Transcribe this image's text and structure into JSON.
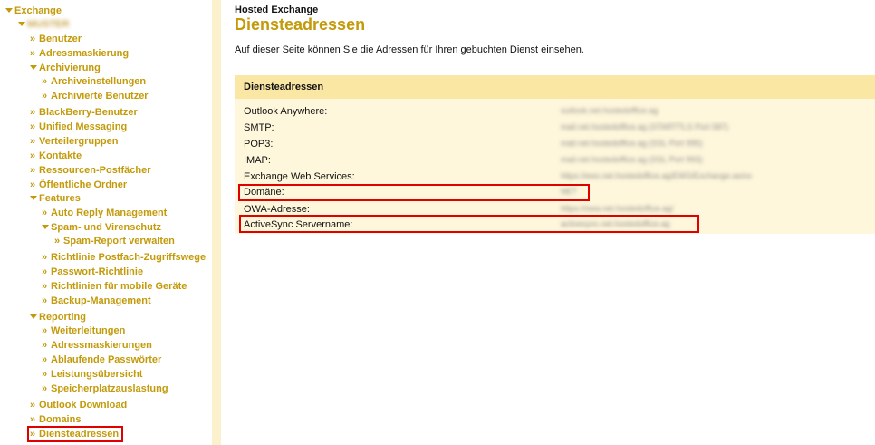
{
  "sidebar": {
    "root": "Exchange",
    "tenant": "MUSTER",
    "items": [
      {
        "label": "Benutzer",
        "level": 1,
        "marker": "»"
      },
      {
        "label": "Adressmaskierung",
        "level": 1,
        "marker": "»"
      },
      {
        "label": "Archivierung",
        "level": 1,
        "marker": "▾"
      },
      {
        "label": "Archiveinstellungen",
        "level": 2,
        "marker": "»"
      },
      {
        "label": "Archivierte Benutzer",
        "level": 2,
        "marker": "»"
      },
      {
        "label": "BlackBerry-Benutzer",
        "level": 1,
        "marker": "»"
      },
      {
        "label": "Unified Messaging",
        "level": 1,
        "marker": "»"
      },
      {
        "label": "Verteilergruppen",
        "level": 1,
        "marker": "»"
      },
      {
        "label": "Kontakte",
        "level": 1,
        "marker": "»"
      },
      {
        "label": "Ressourcen-Postfächer",
        "level": 1,
        "marker": "»"
      },
      {
        "label": "Öffentliche Ordner",
        "level": 1,
        "marker": "»"
      },
      {
        "label": "Features",
        "level": 1,
        "marker": "▾"
      },
      {
        "label": "Auto Reply Management",
        "level": 2,
        "marker": "»"
      },
      {
        "label": "Spam- und Virenschutz",
        "level": 2,
        "marker": "▾"
      },
      {
        "label": "Spam-Report verwalten",
        "level": 3,
        "marker": "»"
      },
      {
        "label": "Richtlinie Postfach-Zugriffswege",
        "level": 2,
        "marker": "»"
      },
      {
        "label": "Passwort-Richtlinie",
        "level": 2,
        "marker": "»"
      },
      {
        "label": "Richtlinien für mobile Geräte",
        "level": 2,
        "marker": "»"
      },
      {
        "label": "Backup-Management",
        "level": 2,
        "marker": "»"
      },
      {
        "label": "Reporting",
        "level": 1,
        "marker": "▾"
      },
      {
        "label": "Weiterleitungen",
        "level": 2,
        "marker": "»"
      },
      {
        "label": "Adressmaskierungen",
        "level": 2,
        "marker": "»"
      },
      {
        "label": "Ablaufende Passwörter",
        "level": 2,
        "marker": "»"
      },
      {
        "label": "Leistungsübersicht",
        "level": 2,
        "marker": "»"
      },
      {
        "label": "Speicherplatzauslastung",
        "level": 2,
        "marker": "»"
      },
      {
        "label": "Outlook Download",
        "level": 1,
        "marker": "»"
      },
      {
        "label": "Domains",
        "level": 1,
        "marker": "»"
      },
      {
        "label": "Diensteadressen",
        "level": 1,
        "marker": "»"
      }
    ]
  },
  "main": {
    "product": "Hosted Exchange",
    "title": "Diensteadressen",
    "intro": "Auf dieser Seite können Sie die Adressen für Ihren gebuchten Dienst einsehen.",
    "panel_title": "Diensteadressen",
    "rows": [
      {
        "label": "Outlook Anywhere:",
        "value": "outlook.net.hostedoffice.ag"
      },
      {
        "label": "SMTP:",
        "value": "mail.net.hostedoffice.ag (STARTTLS Port 587)"
      },
      {
        "label": "POP3:",
        "value": "mail.net.hostedoffice.ag (SSL Port 995)"
      },
      {
        "label": "IMAP:",
        "value": "mail.net.hostedoffice.ag (SSL Port 993)"
      },
      {
        "label": "Exchange Web Services:",
        "value": "https://ews.net.hostedoffice.ag/EWS/Exchange.asmx"
      },
      {
        "label": "Domäne:",
        "value": "NET"
      },
      {
        "label": "OWA-Adresse:",
        "value": "https://owa.net.hostedoffice.ag/"
      },
      {
        "label": "ActiveSync Servername:",
        "value": "activesync.net.hostedoffice.ag"
      }
    ]
  },
  "colors": {
    "accent": "#c39a0a",
    "panel_header": "#fbe7a4",
    "panel_body": "#fff7dc",
    "highlight": "#e00000"
  }
}
